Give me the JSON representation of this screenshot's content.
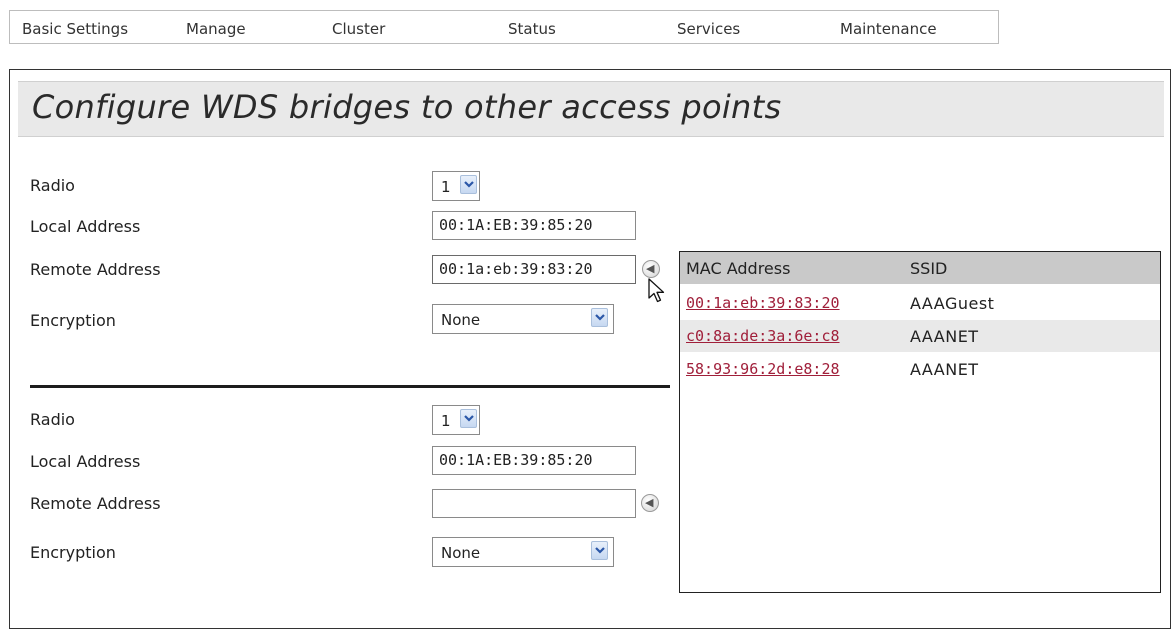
{
  "nav": {
    "items": [
      "Basic Settings",
      "Manage",
      "Cluster",
      "Status",
      "Services",
      "Maintenance"
    ]
  },
  "page": {
    "title": "Configure WDS bridges to other access points"
  },
  "bridges": [
    {
      "radio_label": "Radio",
      "radio_value": "1",
      "local_label": "Local Address",
      "local_value": "00:1A:EB:39:85:20",
      "remote_label": "Remote Address",
      "remote_value": "00:1a:eb:39:83:20",
      "encryption_label": "Encryption",
      "encryption_value": "None"
    },
    {
      "radio_label": "Radio",
      "radio_value": "1",
      "local_label": "Local Address",
      "local_value": "00:1A:EB:39:85:20",
      "remote_label": "Remote Address",
      "remote_value": "",
      "encryption_label": "Encryption",
      "encryption_value": "None"
    }
  ],
  "popup": {
    "header_mac": "MAC Address",
    "header_ssid": "SSID",
    "rows": [
      {
        "mac": "00:1a:eb:39:83:20",
        "ssid": "AAAGuest"
      },
      {
        "mac": "c0:8a:de:3a:6e:c8",
        "ssid": "AAANET"
      },
      {
        "mac": "58:93:96:2d:e8:28",
        "ssid": "AAANET"
      }
    ],
    "row_alt_color": "#e9e9e9",
    "header_color": "#c9c9c9",
    "link_color": "#a01f3a"
  },
  "icons": {
    "dropdown": "chevron-down-icon",
    "scan": "arrow-left-icon",
    "cursor": "mouse-pointer-icon"
  }
}
